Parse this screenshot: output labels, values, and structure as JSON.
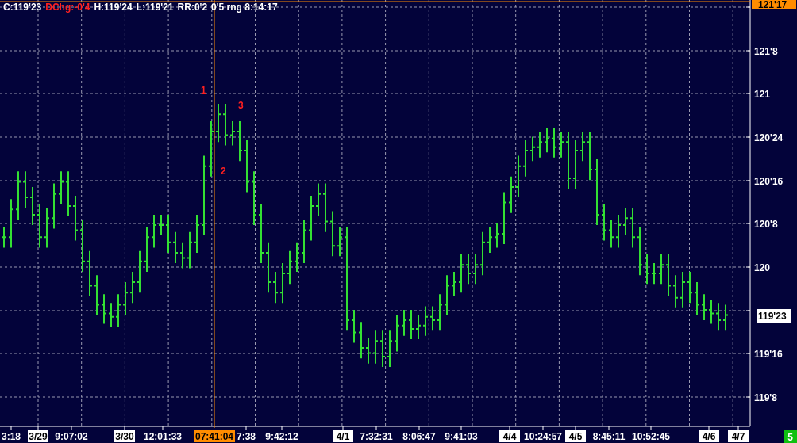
{
  "header": [
    {
      "text": "C:119'23",
      "kind": "value"
    },
    {
      "text": "DChg:-0'4",
      "kind": "change"
    },
    {
      "text": "H:119'24",
      "kind": "value"
    },
    {
      "text": "L:119'21",
      "kind": "value"
    },
    {
      "text": "RR:0'2",
      "kind": "value"
    },
    {
      "text": "0'5 rng 8:14:17",
      "kind": "value"
    }
  ],
  "chart": {
    "annotations": [
      "1",
      "2",
      "3"
    ],
    "y_axis": [
      "121'8",
      "121",
      "120'24",
      "120'16",
      "120'8",
      "120",
      "119'16",
      "119'8"
    ],
    "x_axis": [
      {
        "text": "3:18",
        "kind": "time"
      },
      {
        "text": "3/29",
        "kind": "date"
      },
      {
        "text": "9:07:02",
        "kind": "time"
      },
      {
        "text": "3/30",
        "kind": "date"
      },
      {
        "text": "12:01:33",
        "kind": "time"
      },
      {
        "text": "7:38",
        "kind": "time"
      },
      {
        "text": "9:42:12",
        "kind": "time"
      },
      {
        "text": "4/1",
        "kind": "date"
      },
      {
        "text": "7:32:31",
        "kind": "time"
      },
      {
        "text": "8:06:47",
        "kind": "time"
      },
      {
        "text": "9:41:03",
        "kind": "time"
      },
      {
        "text": "4/4",
        "kind": "date"
      },
      {
        "text": "10:24:57",
        "kind": "time"
      },
      {
        "text": "4/5",
        "kind": "date"
      },
      {
        "text": "8:45:11",
        "kind": "time"
      },
      {
        "text": "10:52:45",
        "kind": "time"
      },
      {
        "text": "4/6",
        "kind": "date"
      },
      {
        "text": "4/7",
        "kind": "date"
      }
    ],
    "cursor": {
      "time": "07:41:04",
      "price": "121'17"
    },
    "last_price": "119'23",
    "corner_badge": "5"
  }
}
